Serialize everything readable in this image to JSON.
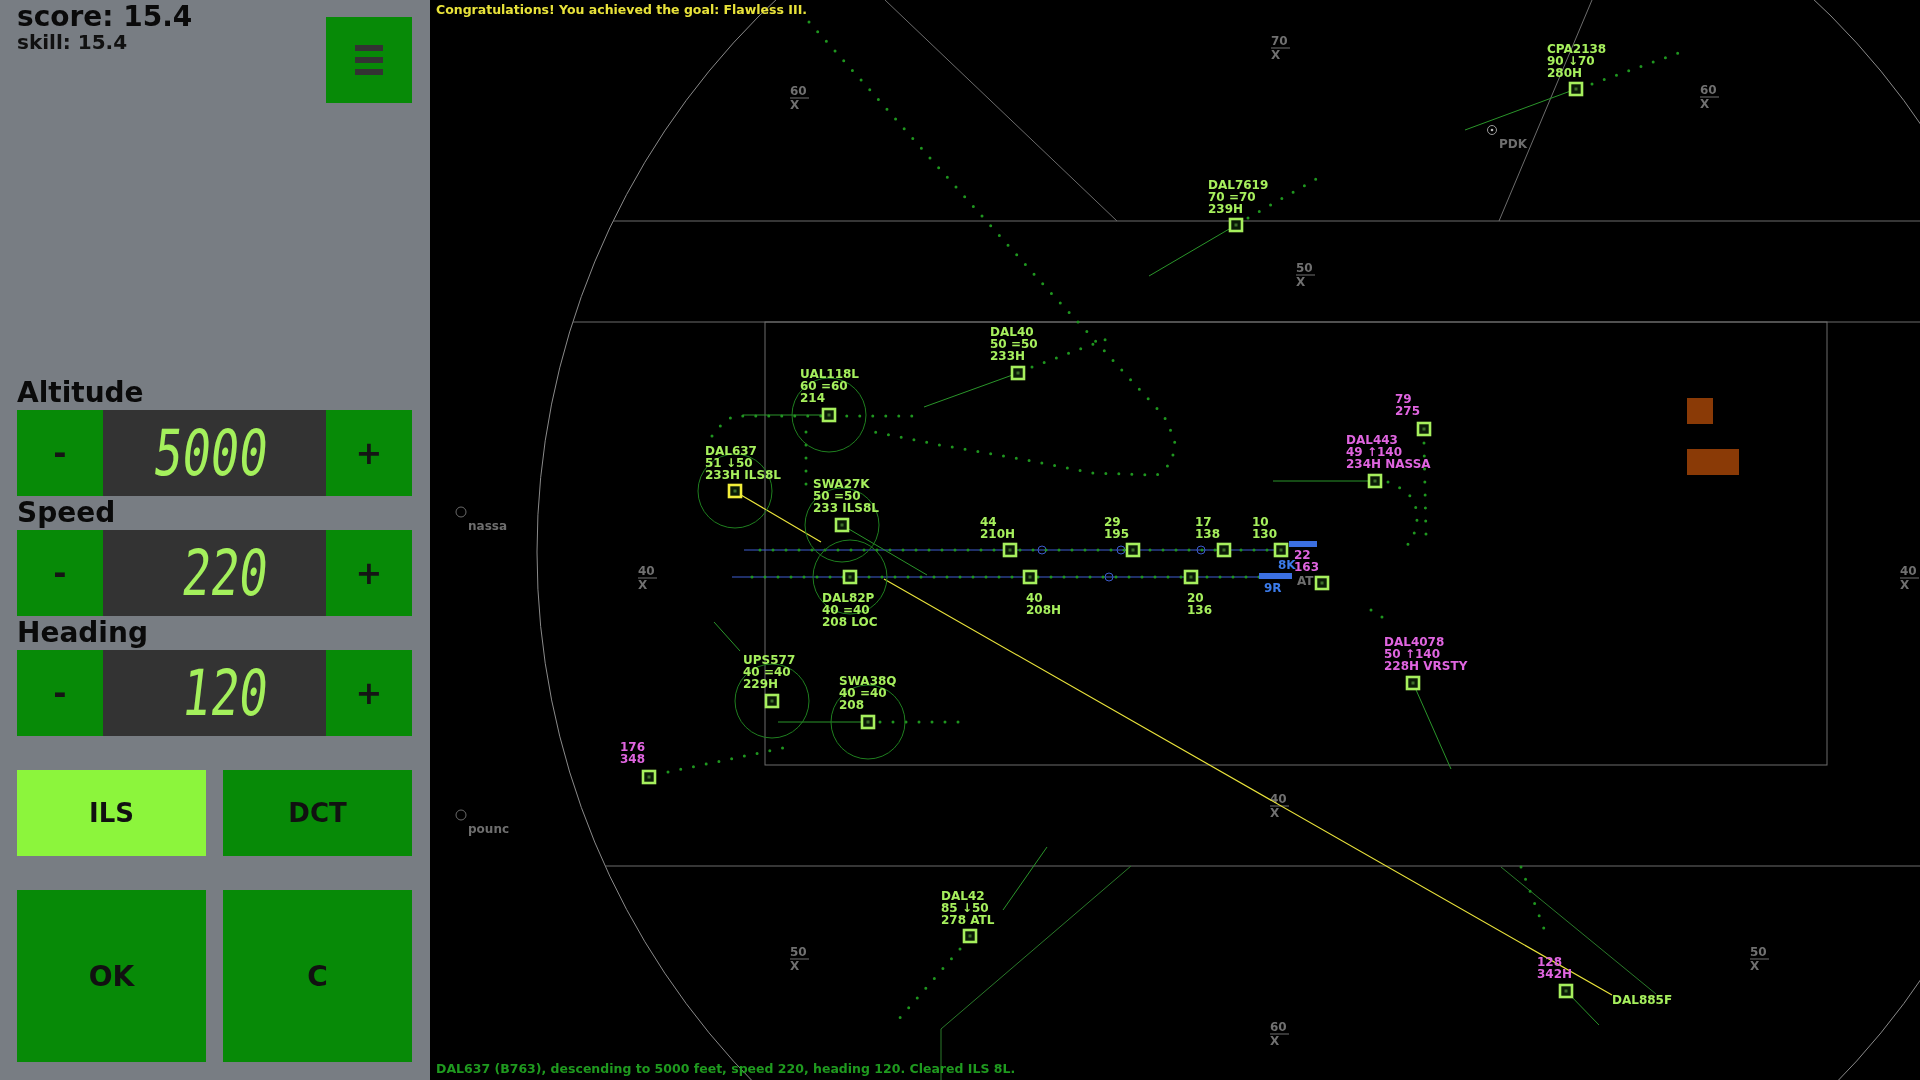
{
  "sidebar": {
    "score": "score: 15.4",
    "skill": "skill: 15.4",
    "controls": [
      {
        "label": "Altitude",
        "decrement": "-",
        "value": "5000",
        "increment": "+"
      },
      {
        "label": "Speed",
        "decrement": "-",
        "value": "220",
        "increment": "+"
      },
      {
        "label": "Heading",
        "decrement": "-",
        "value": "120",
        "increment": "+"
      }
    ],
    "mode_buttons": [
      {
        "label": "ILS",
        "selected": true
      },
      {
        "label": "DCT",
        "selected": false
      }
    ],
    "action_buttons": [
      {
        "label": "OK"
      },
      {
        "label": "C"
      }
    ]
  },
  "radar": {
    "message": "Congratulations! You achieved the goal: Flawless III.",
    "aircraft": [
      {
        "lines": [
          "CPA2138",
          "90 ↓70",
          "280H"
        ],
        "color": "#a6ef5d",
        "selected": false,
        "ring": false
      },
      {
        "lines": [
          "DAL7619",
          "70 =70",
          "239H"
        ],
        "color": "#a6ef5d",
        "selected": false,
        "ring": false
      },
      {
        "lines": [
          "DAL40",
          "50 =50",
          "233H"
        ],
        "color": "#a6ef5d",
        "selected": false,
        "ring": false
      },
      {
        "lines": [
          "UAL118L",
          "60 =60",
          "214"
        ],
        "color": "#a6ef5d",
        "selected": false,
        "ring": true
      },
      {
        "lines": [
          "79",
          "275"
        ],
        "color": "#e065e0",
        "selected": false,
        "ring": false
      },
      {
        "lines": [
          "DAL443",
          "49 ↑140",
          "234H NASSA"
        ],
        "color": "#e065e0",
        "selected": false,
        "ring": false
      },
      {
        "lines": [
          "DAL637",
          "51 ↓50",
          "233H ILS8L"
        ],
        "color": "#a6ef5d",
        "selected": true,
        "ring": true
      },
      {
        "lines": [
          "SWA27K",
          "50 =50",
          "233  ILS8L"
        ],
        "color": "#a6ef5d",
        "selected": false,
        "ring": true
      },
      {
        "lines": [
          "44",
          "210H"
        ],
        "color": "#a6ef5d",
        "selected": false,
        "ring": false
      },
      {
        "lines": [
          "29",
          "195"
        ],
        "color": "#a6ef5d",
        "selected": false,
        "ring": false
      },
      {
        "lines": [
          "17",
          "138"
        ],
        "color": "#a6ef5d",
        "selected": false,
        "ring": false
      },
      {
        "lines": [
          "10",
          "130"
        ],
        "color": "#a6ef5d",
        "selected": false,
        "ring": false
      },
      {
        "lines": [
          "DAL82P",
          "40 =40",
          "208  LOC"
        ],
        "color": "#a6ef5d",
        "selected": false,
        "ring": true
      },
      {
        "lines": [
          "40",
          "208H"
        ],
        "color": "#a6ef5d",
        "selected": false,
        "ring": false
      },
      {
        "lines": [
          "20",
          "136"
        ],
        "color": "#a6ef5d",
        "selected": false,
        "ring": false
      },
      {
        "lines": [
          "22",
          "163"
        ],
        "color": "#e065e0",
        "selected": false,
        "ring": false
      },
      {
        "lines": [
          "DAL4078",
          "50 ↑140",
          "228H VRSTY"
        ],
        "color": "#e065e0",
        "selected": false,
        "ring": false
      },
      {
        "lines": [
          "UPS577",
          "40 =40",
          "229H"
        ],
        "color": "#a6ef5d",
        "selected": false,
        "ring": true
      },
      {
        "lines": [
          "SWA38Q",
          "40 =40",
          "208"
        ],
        "color": "#a6ef5d",
        "selected": false,
        "ring": true
      },
      {
        "lines": [
          "176",
          "348"
        ],
        "color": "#e065e0",
        "selected": false,
        "ring": false
      },
      {
        "lines": [
          "DAL42",
          "85 ↓50",
          "278  ATL"
        ],
        "color": "#a6ef5d",
        "selected": false,
        "ring": false
      },
      {
        "lines": [
          "128",
          "342H"
        ],
        "color": "#e065e0",
        "selected": false,
        "ring": false
      },
      {
        "lines": [
          "DAL885F"
        ],
        "color": "#a6ef5d"
      }
    ],
    "waypoints": [
      {
        "name": "PDK",
        "kind": "vor"
      },
      {
        "name": "nassa",
        "kind": "fix"
      },
      {
        "name": "pounc",
        "kind": "fix"
      }
    ],
    "runway_labels": [
      "8K",
      "9R"
    ],
    "airport_label": "AT",
    "sector_labels": [
      {
        "altitude": "60",
        "mark": "X"
      },
      {
        "altitude": "70",
        "mark": "X"
      },
      {
        "altitude": "60",
        "mark": "X"
      },
      {
        "altitude": "50",
        "mark": "X"
      },
      {
        "altitude": "40",
        "mark": "X"
      },
      {
        "altitude": "40",
        "mark": "X"
      },
      {
        "altitude": "40",
        "mark": "X"
      },
      {
        "altitude": "50",
        "mark": "X"
      },
      {
        "altitude": "50",
        "mark": "X"
      },
      {
        "altitude": "60",
        "mark": "X"
      }
    ],
    "status": "DAL637 (B763), descending to 5000 feet, speed 220, heading 120. Cleared ILS 8L."
  }
}
